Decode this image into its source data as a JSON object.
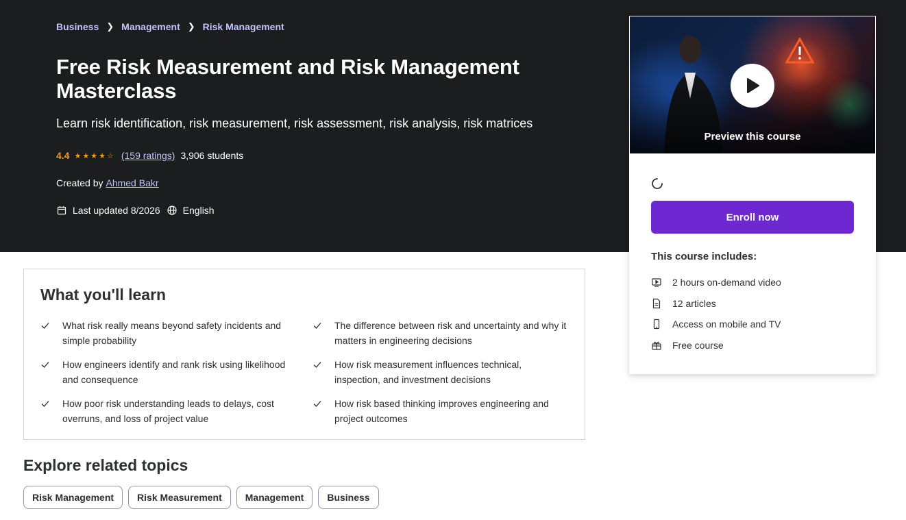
{
  "breadcrumb": [
    {
      "label": "Business"
    },
    {
      "label": "Management"
    },
    {
      "label": "Risk Management"
    }
  ],
  "course": {
    "title": "Free Risk Measurement and Risk Management Masterclass",
    "subtitle": "Learn risk identification, risk measurement, risk assessment, risk analysis, risk matrices",
    "rating": "4.4",
    "stars": 4.4,
    "ratings_count": "(159 ratings)",
    "students": "3,906 students",
    "created_by_label": "Created by",
    "author": "Ahmed Bakr",
    "last_updated": "Last updated 8/2026",
    "language": "English"
  },
  "card": {
    "preview_label": "Preview this course",
    "enroll_label": "Enroll now",
    "includes_title": "This course includes:",
    "includes": [
      {
        "icon": "video-icon",
        "label": "2 hours on-demand video"
      },
      {
        "icon": "article-icon",
        "label": "12 articles"
      },
      {
        "icon": "mobile-icon",
        "label": "Access on mobile and TV"
      },
      {
        "icon": "gift-icon",
        "label": "Free course"
      }
    ]
  },
  "learn": {
    "title": "What you'll learn",
    "items": [
      "What risk really means beyond safety incidents and simple probability",
      "The difference between risk and uncertainty and why it matters in engineering decisions",
      "How engineers identify and rank risk using likelihood and consequence",
      "How risk measurement influences technical, inspection, and investment decisions",
      "How poor risk understanding leads to delays, cost overruns, and loss of project value",
      "How risk based thinking improves engineering and project outcomes"
    ]
  },
  "explore": {
    "title": "Explore related topics",
    "topics": [
      "Risk Management",
      "Risk Measurement",
      "Management",
      "Business"
    ]
  },
  "colors": {
    "hero_bg": "#1c1d1f",
    "accent": "#6d28d2",
    "link": "#c0c4fc",
    "star": "#f69c08"
  }
}
